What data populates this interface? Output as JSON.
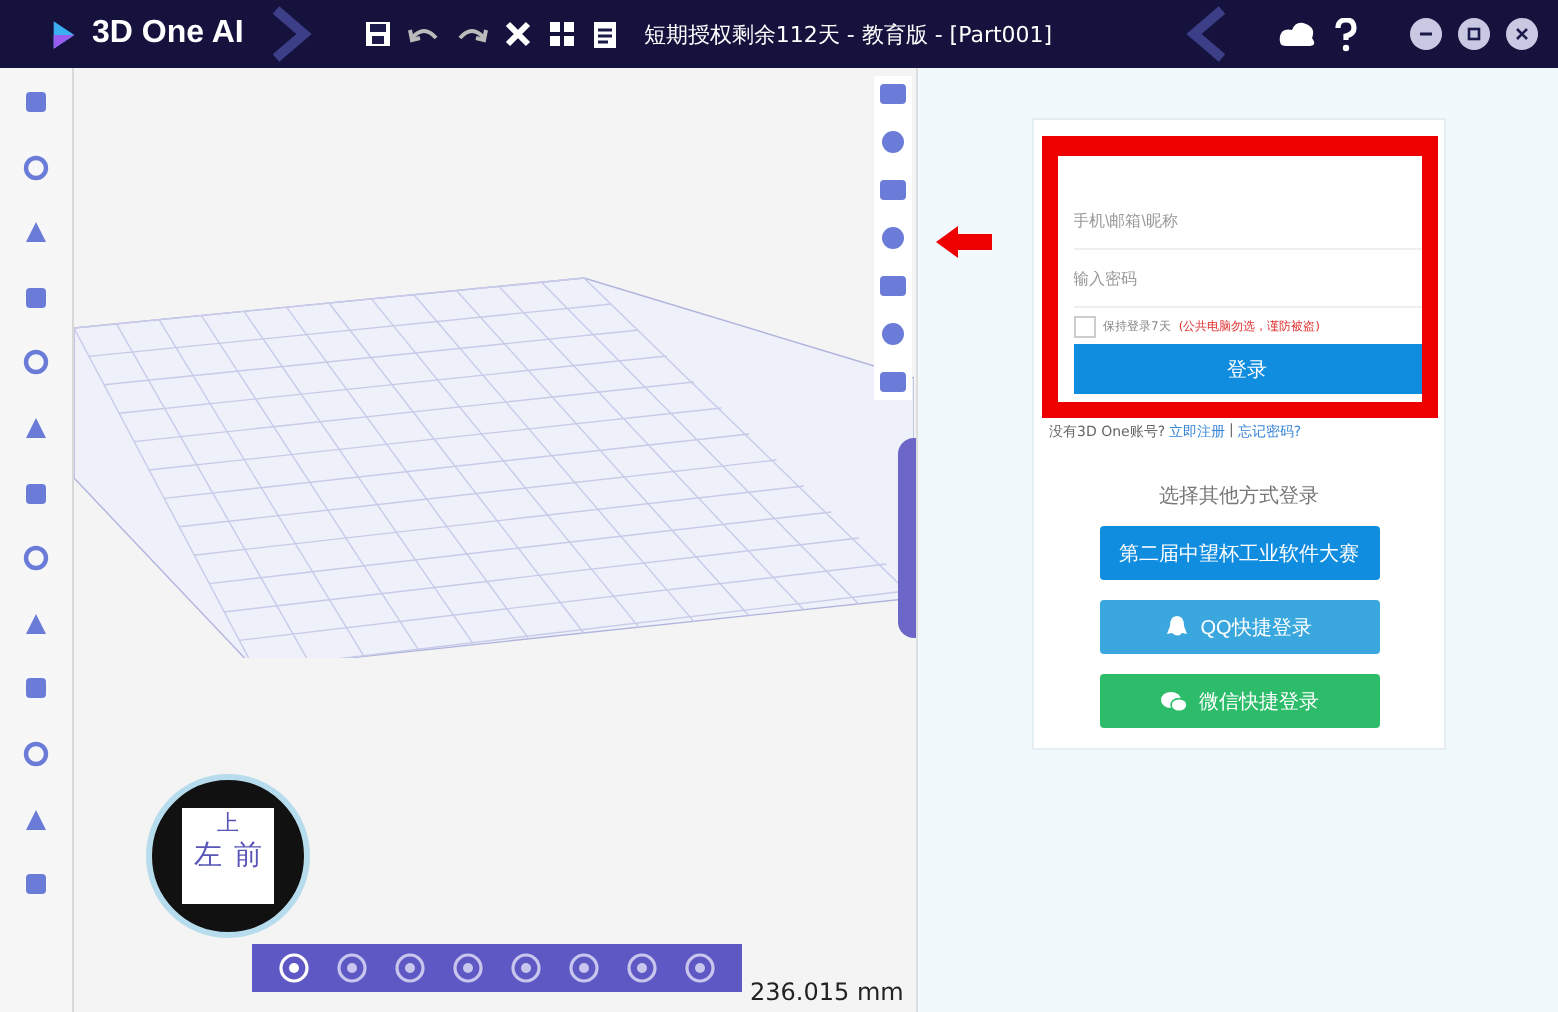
{
  "titlebar": {
    "app_name": "3D One AI",
    "document_title": "短期授权剩余112天 - 教育版 - [Part001]"
  },
  "viewport": {
    "view_cube": {
      "top": "上",
      "left": "左",
      "front": "前"
    },
    "scale": "236.015 mm"
  },
  "login": {
    "account": {
      "placeholder": "手机\\邮箱\\昵称"
    },
    "password": {
      "placeholder": "输入密码"
    },
    "remember": {
      "label": "保持登录7天",
      "checked": false,
      "warning": "(公共电脑勿选，谨防被盗)"
    },
    "submit": "登录",
    "footer": {
      "text": "没有3D One账号?",
      "register": "立即注册",
      "separator": "|",
      "forgot": "忘记密码?"
    },
    "alt_heading": "选择其他方式登录",
    "alt_buttons": [
      {
        "kind": "contest",
        "label": "第二届中望杯工业软件大赛"
      },
      {
        "kind": "qq",
        "label": "QQ快捷登录"
      },
      {
        "kind": "wechat",
        "label": "微信快捷登录"
      }
    ]
  }
}
